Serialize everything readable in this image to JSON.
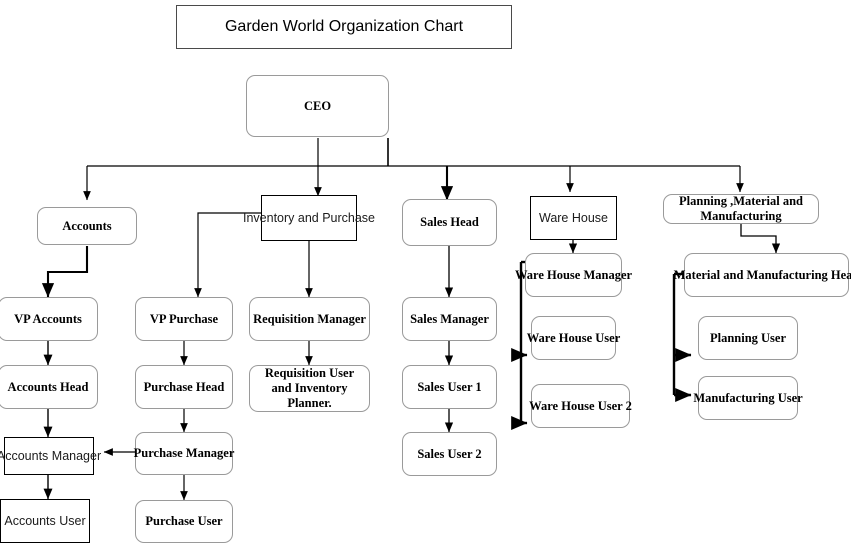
{
  "title": {
    "text": "Garden World Organization Chart"
  },
  "nodes": {
    "ceo": "CEO",
    "accounts": "Accounts",
    "inventory_purchase": "Inventory and Purchase",
    "sales_head": "Sales Head",
    "ware_house": "Ware House",
    "planning_material": "Planning ,Material and Manufacturing",
    "vp_accounts": "VP Accounts",
    "accounts_head": "Accounts Head",
    "accounts_manager": "Accounts Manager",
    "accounts_user": "Accounts User",
    "vp_purchase": "VP Purchase",
    "purchase_head": "Purchase Head",
    "purchase_manager": "Purchase Manager",
    "purchase_user": "Purchase User",
    "requisition_manager": "Requisition Manager",
    "requisition_user": "Requisition User and Inventory Planner.",
    "sales_manager": "Sales Manager",
    "sales_user_1": "Sales User 1",
    "sales_user_2": "Sales User 2",
    "ware_house_manager": "Ware House Manager",
    "ware_house_user": "Ware House User",
    "ware_house_user_2": "Ware House User 2",
    "material_manufacturing_head": "Material and Manufacturing Head",
    "planning_user": "Planning User",
    "manufacturing_user": "Manufacturing User"
  },
  "colors": {
    "line": "#000000",
    "rounded_border": "#9a9a9a",
    "sharp_border": "#000000",
    "background": "#ffffff",
    "title_border": "#4a4a4a"
  }
}
